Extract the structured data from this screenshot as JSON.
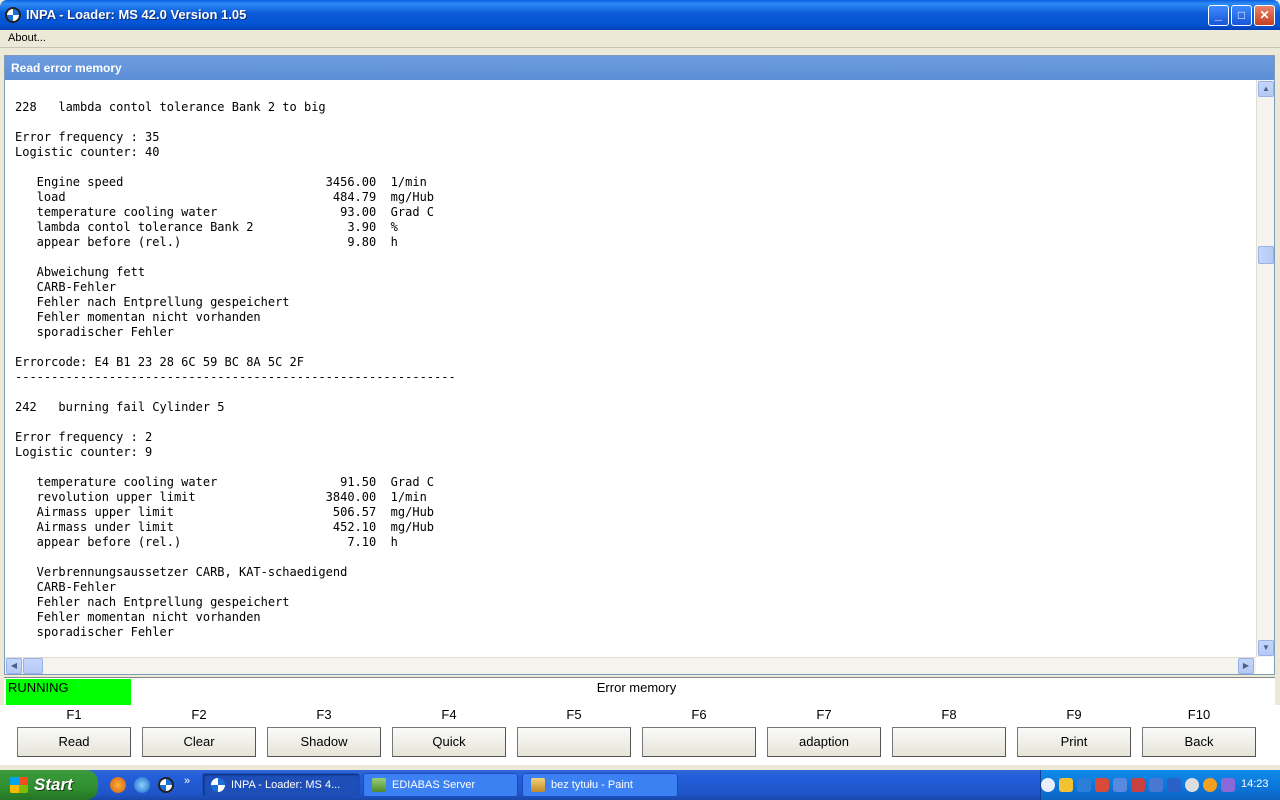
{
  "window": {
    "title": "INPA - Loader:  MS 42.0 Version 1.05",
    "min_label": "_",
    "max_label": "□",
    "close_label": "✕"
  },
  "menu": {
    "about": "About..."
  },
  "panel": {
    "title": "Read error memory",
    "lines": [
      "228   lambda contol tolerance Bank 2 to big",
      "",
      "Error frequency : 35",
      "Logistic counter: 40",
      "",
      "   Engine speed                            3456.00  1/min",
      "   load                                     484.79  mg/Hub",
      "   temperature cooling water                 93.00  Grad C",
      "   lambda contol tolerance Bank 2             3.90  %",
      "   appear before (rel.)                       9.80  h",
      "",
      "   Abweichung fett",
      "   CARB-Fehler",
      "   Fehler nach Entprellung gespeichert",
      "   Fehler momentan nicht vorhanden",
      "   sporadischer Fehler",
      "",
      "Errorcode: E4 B1 23 28 6C 59 BC 8A 5C 2F",
      "-------------------------------------------------------------",
      "",
      "242   burning fail Cylinder 5",
      "",
      "Error frequency : 2",
      "Logistic counter: 9",
      "",
      "   temperature cooling water                 91.50  Grad C",
      "   revolution upper limit                  3840.00  1/min",
      "   Airmass upper limit                      506.57  mg/Hub",
      "   Airmass under limit                      452.10  mg/Hub",
      "   appear before (rel.)                       7.10  h",
      "",
      "   Verbrennungsaussetzer CARB, KAT-schaedigend",
      "   CARB-Fehler",
      "   Fehler nach Entprellung gespeichert",
      "   Fehler momentan nicht vorhanden",
      "   sporadischer Fehler"
    ]
  },
  "status": {
    "state": "RUNNING",
    "state_color": "#00ff00",
    "title": "Error memory"
  },
  "fkeys": [
    {
      "key": "F1",
      "label": "Read"
    },
    {
      "key": "F2",
      "label": "Clear"
    },
    {
      "key": "F3",
      "label": "Shadow"
    },
    {
      "key": "F4",
      "label": "Quick"
    },
    {
      "key": "F5",
      "label": ""
    },
    {
      "key": "F6",
      "label": ""
    },
    {
      "key": "F7",
      "label": "adaption"
    },
    {
      "key": "F8",
      "label": ""
    },
    {
      "key": "F9",
      "label": "Print"
    },
    {
      "key": "F10",
      "label": "Back"
    }
  ],
  "taskbar": {
    "start": "Start",
    "more": "»",
    "tasks": [
      {
        "label": "INPA - Loader:  MS 4...",
        "icon": "bmw-icon",
        "active": true
      },
      {
        "label": "EDIABAS Server",
        "icon": "server-icon",
        "active": false
      },
      {
        "label": "bez tytułu - Paint",
        "icon": "paint-icon",
        "active": false
      }
    ],
    "clock": "14:23"
  },
  "colors": {
    "titlebar": "#0454d3",
    "panel_title": "#5c8ed6",
    "taskbar": "#245edb",
    "start": "#2f8f2f"
  }
}
